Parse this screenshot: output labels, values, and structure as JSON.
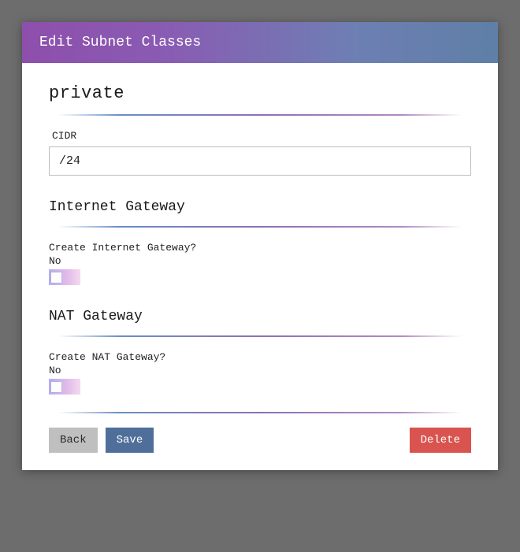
{
  "header": {
    "title": "Edit Subnet Classes"
  },
  "main": {
    "name": "private"
  },
  "cidr": {
    "label": "CIDR",
    "value": "/24"
  },
  "internet_gateway": {
    "heading": "Internet Gateway",
    "question": "Create Internet Gateway?",
    "state": "No"
  },
  "nat_gateway": {
    "heading": "NAT Gateway",
    "question": "Create NAT Gateway?",
    "state": "No"
  },
  "buttons": {
    "back": "Back",
    "save": "Save",
    "delete": "Delete"
  }
}
